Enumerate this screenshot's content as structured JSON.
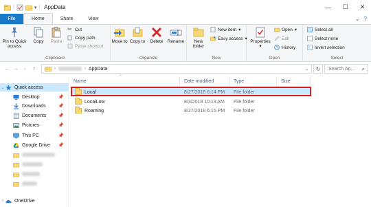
{
  "window": {
    "title": "AppData",
    "minimize": "—",
    "maximize": "☐",
    "close": "✕"
  },
  "tabs": {
    "file": "File",
    "home": "Home",
    "share": "Share",
    "view": "View"
  },
  "ribbon": {
    "clipboard": {
      "label": "Clipboard",
      "pin": "Pin to Quick access",
      "copy": "Copy",
      "paste": "Paste",
      "cut": "Cut",
      "copy_path": "Copy path",
      "paste_shortcut": "Paste shortcut"
    },
    "organize": {
      "label": "Organize",
      "move_to": "Move to",
      "copy_to": "Copy to",
      "delete": "Delete",
      "rename": "Rename"
    },
    "new": {
      "label": "New",
      "new_folder": "New folder",
      "new_item": "New item",
      "easy_access": "Easy access"
    },
    "open": {
      "label": "Open",
      "properties": "Properties",
      "open": "Open",
      "edit": "Edit",
      "history": "History"
    },
    "select": {
      "label": "Select",
      "select_all": "Select all",
      "select_none": "Select none",
      "invert_selection": "Invert selection"
    }
  },
  "address": {
    "current": "AppData",
    "search_placeholder": "Search Ap..."
  },
  "nav": {
    "items": [
      {
        "label": "Quick access",
        "icon": "star-icon"
      },
      {
        "label": "Desktop",
        "icon": "desktop-icon"
      },
      {
        "label": "Downloads",
        "icon": "downloads-icon"
      },
      {
        "label": "Documents",
        "icon": "documents-icon"
      },
      {
        "label": "Pictures",
        "icon": "pictures-icon"
      },
      {
        "label": "This PC",
        "icon": "computer-icon"
      },
      {
        "label": "Google Drive",
        "icon": "google-drive-icon"
      },
      {
        "label": "OneDrive",
        "icon": "onedrive-icon"
      }
    ]
  },
  "columns": {
    "name": "Name",
    "date": "Date modified",
    "type": "Type",
    "size": "Size"
  },
  "files": [
    {
      "name": "Local",
      "date": "8/27/2018 6:14 PM",
      "type": "File folder"
    },
    {
      "name": "LocalLow",
      "date": "8/3/2018 10:13 AM",
      "type": "File folder"
    },
    {
      "name": "Roaming",
      "date": "8/27/2018 6:15 PM",
      "type": "File folder"
    }
  ],
  "colors": {
    "accent": "#1979ca",
    "selection": "#cce8ff",
    "highlight": "#d81f1f",
    "folder": "#f8d775"
  }
}
